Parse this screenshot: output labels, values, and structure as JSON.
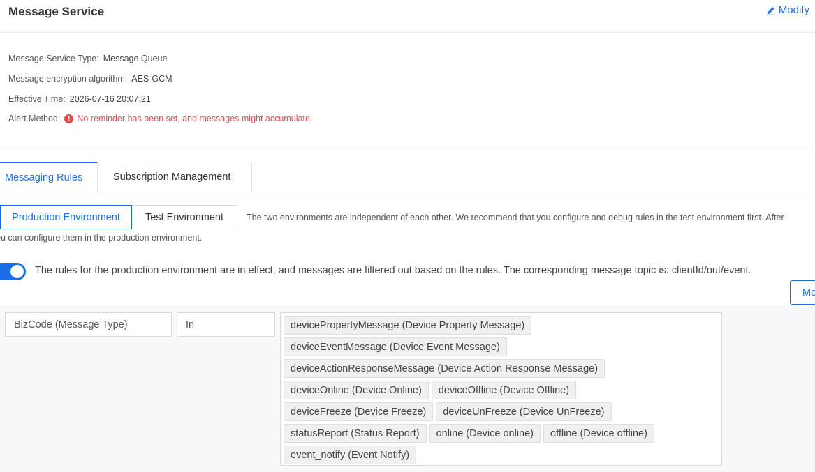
{
  "header": {
    "title": "Message Service",
    "modify_label": "Modify"
  },
  "info": {
    "service_type_label": "Message Service Type:",
    "service_type_value": "Message Queue",
    "encryption_label": "Message encryption algorithm:",
    "encryption_value": "AES-GCM",
    "effective_label": "Effective Time:",
    "effective_value": "2026-07-16 20:07:21",
    "alert_label": "Alert Method:",
    "alert_icon": "!",
    "alert_value": "No reminder has been set, and messages might accumulate."
  },
  "tabs": {
    "messaging_rules": "Messaging Rules",
    "subscription_management": "Subscription Management"
  },
  "environment": {
    "production_label": "Production Environment",
    "test_label": "Test Environment",
    "description_line1": "The two environments are independent of each other. We recommend that you configure and debug rules in the test environment first. After",
    "description_line2": "ou can configure them in the production environment."
  },
  "rules_toggle": {
    "text": "The rules for the production environment are in effect, and messages are filtered out based on the rules. The corresponding message topic is: clientId/out/event.",
    "button_label": "Mo"
  },
  "rule": {
    "field": "BizCode (Message Type)",
    "operator": "In",
    "tag_rows": [
      [
        "devicePropertyMessage (Device Property Message)"
      ],
      [
        "deviceEventMessage (Device Event Message)"
      ],
      [
        "deviceActionResponseMessage (Device Action Response Message)"
      ],
      [
        "deviceOnline (Device Online)",
        "deviceOffline (Device Offline)"
      ],
      [
        "deviceFreeze (Device Freeze)",
        "deviceUnFreeze (Device UnFreeze)"
      ],
      [
        "statusReport (Status Report)",
        "online (Device online)",
        "offline (Device offline)"
      ],
      [
        "event_notify (Event Notify)"
      ]
    ]
  },
  "colors": {
    "accent": "#1b6ee8",
    "alert": "#e5484d"
  }
}
